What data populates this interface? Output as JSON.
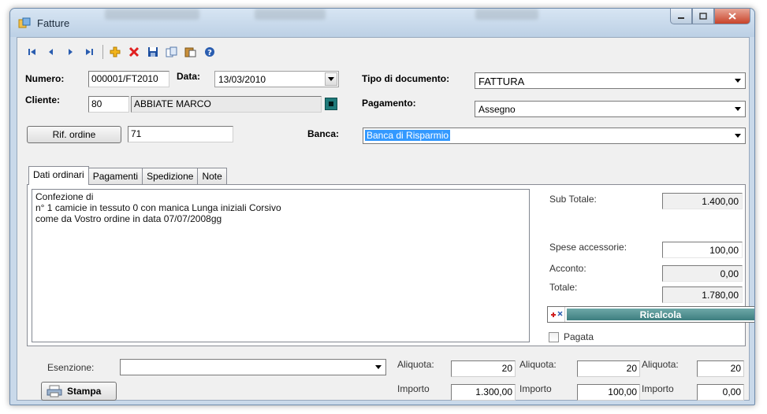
{
  "window": {
    "title": "Fatture"
  },
  "toolbar": {
    "buttons": [
      {
        "name": "first-record-icon"
      },
      {
        "name": "prev-record-icon"
      },
      {
        "name": "next-record-icon"
      },
      {
        "name": "last-record-icon"
      },
      {
        "name": "add-record-icon"
      },
      {
        "name": "delete-record-icon"
      },
      {
        "name": "save-icon"
      },
      {
        "name": "copy-icon"
      },
      {
        "name": "paste-icon"
      },
      {
        "name": "help-icon"
      }
    ]
  },
  "header": {
    "numero_label": "Numero:",
    "numero_value": "000001/FT2010",
    "data_label": "Data:",
    "data_value": "13/03/2010",
    "tipo_label": "Tipo di documento:",
    "tipo_value": "FATTURA",
    "cliente_label": "Cliente:",
    "cliente_code": "80",
    "cliente_name": "ABBIATE MARCO",
    "pagamento_label": "Pagamento:",
    "pagamento_value": "Assegno",
    "rif_ordine_label": "Rif. ordine",
    "rif_ordine_value": "71",
    "banca_label": "Banca:",
    "banca_value": "Banca di Risparmio"
  },
  "tabs": [
    "Dati ordinari",
    "Pagamenti",
    "Spedizione",
    "Note"
  ],
  "memo_lines": [
    "Confezione di",
    "n° 1 camicie in tessuto 0 con manica Lunga iniziali Corsivo",
    "come da Vostro ordine in data 07/07/2008gg"
  ],
  "totals": {
    "subtotale_label": "Sub Totale:",
    "subtotale_value": "1.400,00",
    "spese_label": "Spese accessorie:",
    "spese_value": "100,00",
    "acconto_label": "Acconto:",
    "acconto_value": "0,00",
    "totale_label": "Totale:",
    "totale_value": "1.780,00",
    "ricalcola_label": "Ricalcola",
    "pagata_label": "Pagata"
  },
  "footer": {
    "esenzione_label": "Esenzione:",
    "esenzione_value": "",
    "stampa_label": "Stampa",
    "aliquota_label": "Aliquota:",
    "importo_label": "Importo",
    "aliquote": [
      "20",
      "20",
      "20"
    ],
    "importi": [
      "1.300,00",
      "100,00",
      "0,00"
    ]
  },
  "colors": {
    "accent_teal": "#3d7e7f",
    "selection_blue": "#3399ff",
    "close_red": "#c8432a"
  }
}
